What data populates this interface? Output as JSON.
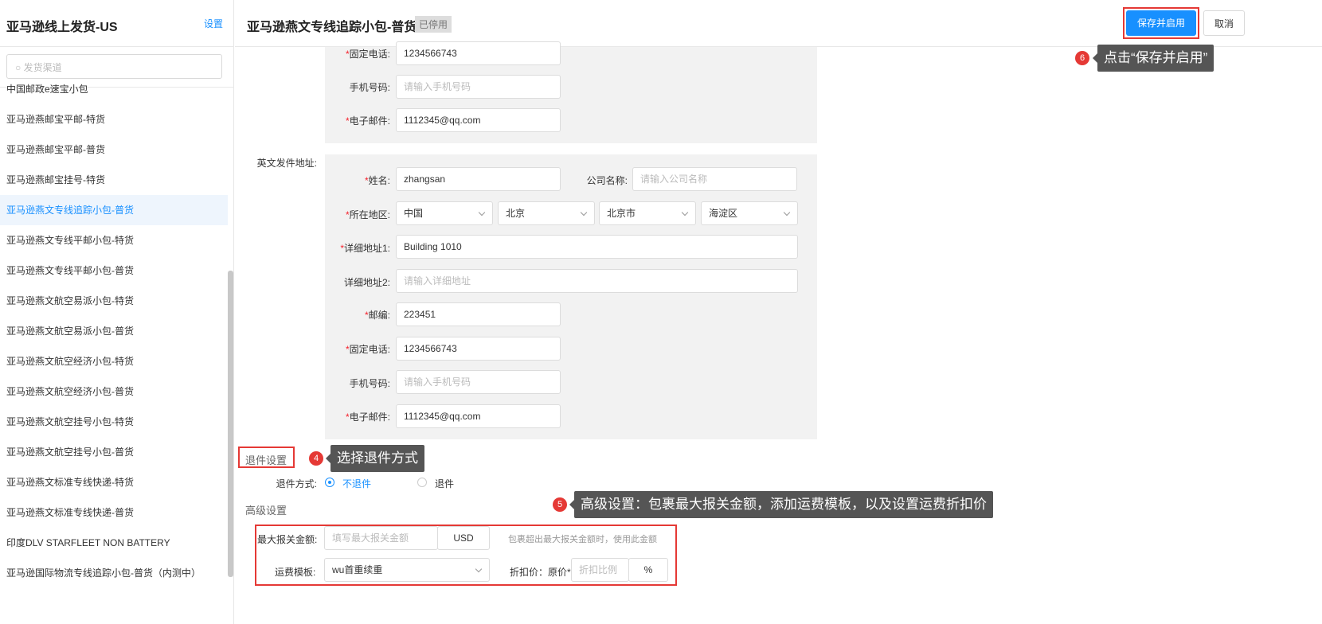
{
  "sidebar": {
    "title": "亚马逊线上发货-US",
    "settings_link": "设置",
    "search_placeholder": "发货渠道",
    "items": [
      "中国邮政e速宝小包",
      "亚马逊燕邮宝平邮-特货",
      "亚马逊燕邮宝平邮-普货",
      "亚马逊燕邮宝挂号-特货",
      "亚马逊燕文专线追踪小包-普货",
      "亚马逊燕文专线平邮小包-特货",
      "亚马逊燕文专线平邮小包-普货",
      "亚马逊燕文航空易派小包-特货",
      "亚马逊燕文航空易派小包-普货",
      "亚马逊燕文航空经济小包-特货",
      "亚马逊燕文航空经济小包-普货",
      "亚马逊燕文航空挂号小包-特货",
      "亚马逊燕文航空挂号小包-普货",
      "亚马逊燕文标准专线快递-特货",
      "亚马逊燕文标准专线快递-普货",
      "印度DLV STARFLEET NON BATTERY",
      "亚马逊国际物流专线追踪小包-普货（内测中）"
    ]
  },
  "header": {
    "title": "亚马逊燕文专线追踪小包-普货",
    "status": "已停用",
    "save_enable": "保存并启用",
    "cancel": "取消"
  },
  "top_section": {
    "phone_label": "固定电话:",
    "phone": "1234566743",
    "mobile_label": "手机号码:",
    "mobile_placeholder": "请输入手机号码",
    "email_label": "电子邮件:",
    "email": "1112345@qq.com"
  },
  "en_address": {
    "label": "英文发件地址:",
    "name_label": "姓名:",
    "name": "zhangsan",
    "company_label": "公司名称:",
    "company_placeholder": "请输入公司名称",
    "region_label": "所在地区:",
    "country": "中国",
    "province": "北京",
    "city": "北京市",
    "district": "海淀区",
    "addr1_label": "详细地址1:",
    "addr1": "Building 1010",
    "addr2_label": "详细地址2:",
    "addr2_placeholder": "请输入详细地址",
    "zip_label": "邮编:",
    "zip": "223451",
    "phone_label": "固定电话:",
    "phone": "1234566743",
    "mobile_label": "手机号码:",
    "mobile_placeholder": "请输入手机号码",
    "email_label": "电子邮件:",
    "email": "1112345@qq.com"
  },
  "return": {
    "title": "退件设置",
    "method_label": "退件方式:",
    "opt_no": "不退件",
    "opt_yes": "退件"
  },
  "advanced": {
    "title": "高级设置",
    "max_label": "最大报关金额:",
    "max_placeholder": "填写最大报关金额",
    "currency": "USD",
    "max_hint": "包裹超出最大报关金额时，使用此金额",
    "template_label": "运费模板:",
    "template": "wu首重续重",
    "discount_label": "折扣价：原价*",
    "discount_placeholder": "折扣比例",
    "percent": "%"
  },
  "annotations": {
    "n4": "4",
    "t4": "选择退件方式",
    "n5": "5",
    "t5": "高级设置：包裹最大报关金额，添加运费模板，以及设置运费折扣价",
    "n6": "6",
    "t6": "点击“保存并启用”"
  }
}
